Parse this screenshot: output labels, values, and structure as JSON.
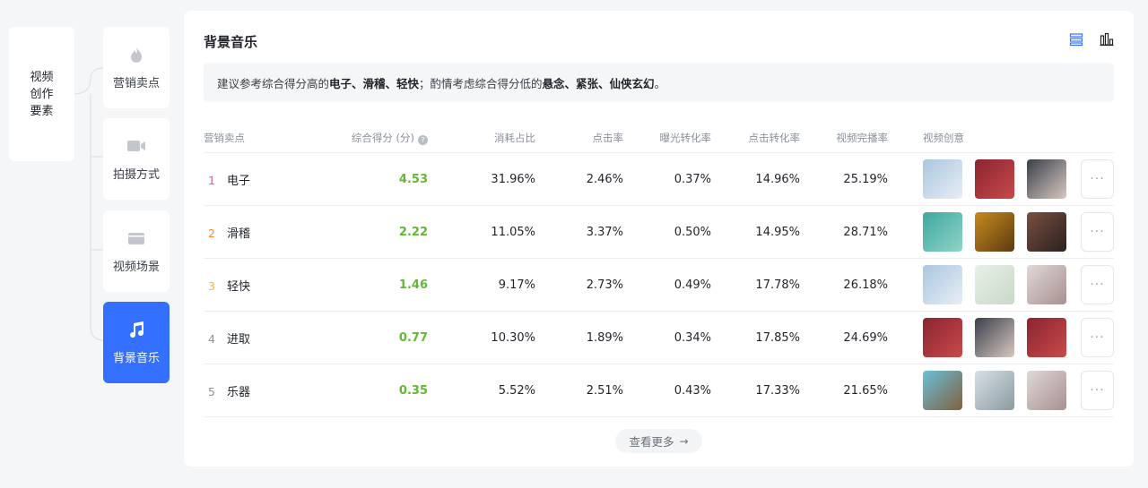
{
  "root": {
    "label": "视频创作要素"
  },
  "nav": [
    {
      "id": "selling",
      "label": "营销卖点",
      "icon": "flame-icon",
      "active": false
    },
    {
      "id": "shooting",
      "label": "拍摄方式",
      "icon": "video-camera-icon",
      "active": false
    },
    {
      "id": "scene",
      "label": "视频场景",
      "icon": "clapperboard-icon",
      "active": false
    },
    {
      "id": "music",
      "label": "背景音乐",
      "icon": "music-note-icon",
      "active": true
    }
  ],
  "main": {
    "title": "背景音乐",
    "view_icons": [
      "list-view-icon",
      "bar-chart-view-icon"
    ],
    "tip": {
      "prefix": "建议参考综合得分高的 ",
      "high": "电子、滑稽、轻快",
      "middle": "；酌情考虑综合得分低的 ",
      "low": "悬念、紧张、仙侠玄幻",
      "suffix": " 。"
    },
    "headers": {
      "name": "营销卖点",
      "score": "综合得分 (分)",
      "cost": "消耗占比",
      "ctr": "点击率",
      "exposure": "曝光转化率",
      "click_conv": "点击转化率",
      "completion": "视频完播率",
      "video": "视频创意"
    },
    "rows": [
      {
        "rank": "1",
        "name": "电子",
        "score": "4.53",
        "cost": "31.96%",
        "ctr": "2.46%",
        "exposure": "0.37%",
        "click_conv": "14.96%",
        "completion": "25.19%"
      },
      {
        "rank": "2",
        "name": "滑稽",
        "score": "2.22",
        "cost": "11.05%",
        "ctr": "3.37%",
        "exposure": "0.50%",
        "click_conv": "14.95%",
        "completion": "28.71%"
      },
      {
        "rank": "3",
        "name": "轻快",
        "score": "1.46",
        "cost": "9.17%",
        "ctr": "2.73%",
        "exposure": "0.49%",
        "click_conv": "17.78%",
        "completion": "26.18%"
      },
      {
        "rank": "4",
        "name": "进取",
        "score": "0.77",
        "cost": "10.30%",
        "ctr": "1.89%",
        "exposure": "0.34%",
        "click_conv": "17.85%",
        "completion": "24.69%"
      },
      {
        "rank": "5",
        "name": "乐器",
        "score": "0.35",
        "cost": "5.52%",
        "ctr": "2.51%",
        "exposure": "0.43%",
        "click_conv": "17.33%",
        "completion": "21.65%"
      }
    ],
    "rank_colors": [
      "#f5587b",
      "#f5882c",
      "#f5b82c",
      "#8a8f99",
      "#8a8f99"
    ],
    "more_label": "···",
    "see_more": "查看更多"
  }
}
